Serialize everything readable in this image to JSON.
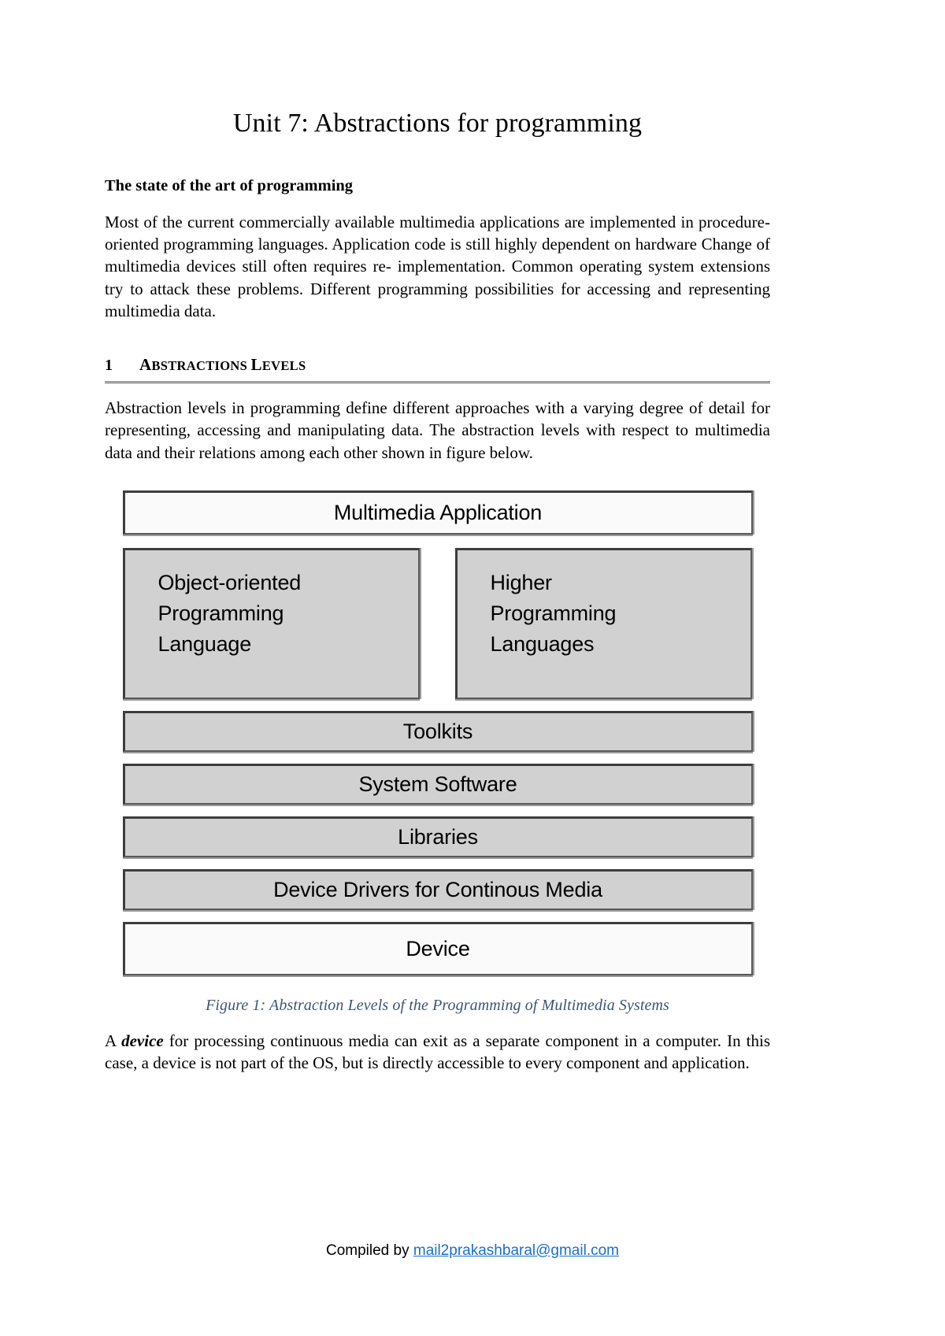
{
  "document": {
    "title": "Unit 7: Abstractions for programming",
    "intro_heading": "The state of the art of programming",
    "intro_paragraph": "Most of the current commercially available multimedia applications are implemented in procedure-oriented programming languages. Application code is still highly dependent on hardware Change of multimedia devices still often requires re- implementation. Common operating system extensions try to attack these problems. Different programming possibilities for accessing and representing multimedia data.",
    "section": {
      "number": "1",
      "title_first_letter": "A",
      "title_rest": "BSTRACTIONS",
      "title_second_first_letter": "L",
      "title_second_rest": "EVELS",
      "title_full": "ABSTRACTIONS LEVELS",
      "paragraph": "Abstraction levels in programming define different approaches with a varying degree of detail for representing, accessing and manipulating data. The abstraction levels with respect to multimedia data and their relations among each other shown in figure below."
    },
    "closing_paragraph": {
      "lead": "A ",
      "emphasis": "device",
      "rest": " for processing continuous media can exit as a separate component in a computer. In this case, a device is not part of the OS, but is directly accessible to every component and application."
    }
  },
  "figure": {
    "caption": "Figure 1: Abstraction Levels of the Programming of Multimedia Systems",
    "caption_color": "#3c5572",
    "box_fill_gray": "#d1d1d1",
    "box_fill_light": "#fafafa",
    "box_border": "#3d3d3d",
    "boxes": {
      "application": "Multimedia Application",
      "left_column": "Object-oriented Programming Language",
      "right_column": "Higher Programming Languages",
      "toolkits": "Toolkits",
      "system_software": "System Software",
      "libraries": "Libraries",
      "device_drivers": "Device Drivers for Continous Media",
      "device": "Device"
    }
  },
  "footer": {
    "prefix": "Compiled by ",
    "email": "mail2prakashbaral@gmail.com",
    "link_color": "#1a6fc9"
  }
}
